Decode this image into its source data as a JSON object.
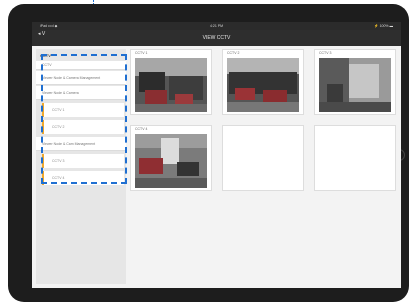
{
  "status_bar": {
    "left": "iPad ••••l  ◆",
    "center": "4:21 PM",
    "right": "⚡ 100% ▬"
  },
  "nav": {
    "back_label": "◂ V",
    "title": "VIEW CCTV",
    "subtitle": ""
  },
  "sidebar": {
    "header": "CCTV",
    "items": [
      "CCTV",
      "Viewer Node & Camera Management",
      "Viewer Node & Camera"
    ],
    "subitems_1": [
      "CCTV 1",
      "CCTV 2"
    ],
    "group2": "Viewer Node & Cam Management",
    "subitems_2": [
      "CCTV 3",
      "CCTV 4"
    ]
  },
  "cameras": [
    {
      "label": "CCTV 1"
    },
    {
      "label": "CCTV 2"
    },
    {
      "label": "CCTV 3"
    },
    {
      "label": "CCTV 4"
    }
  ]
}
